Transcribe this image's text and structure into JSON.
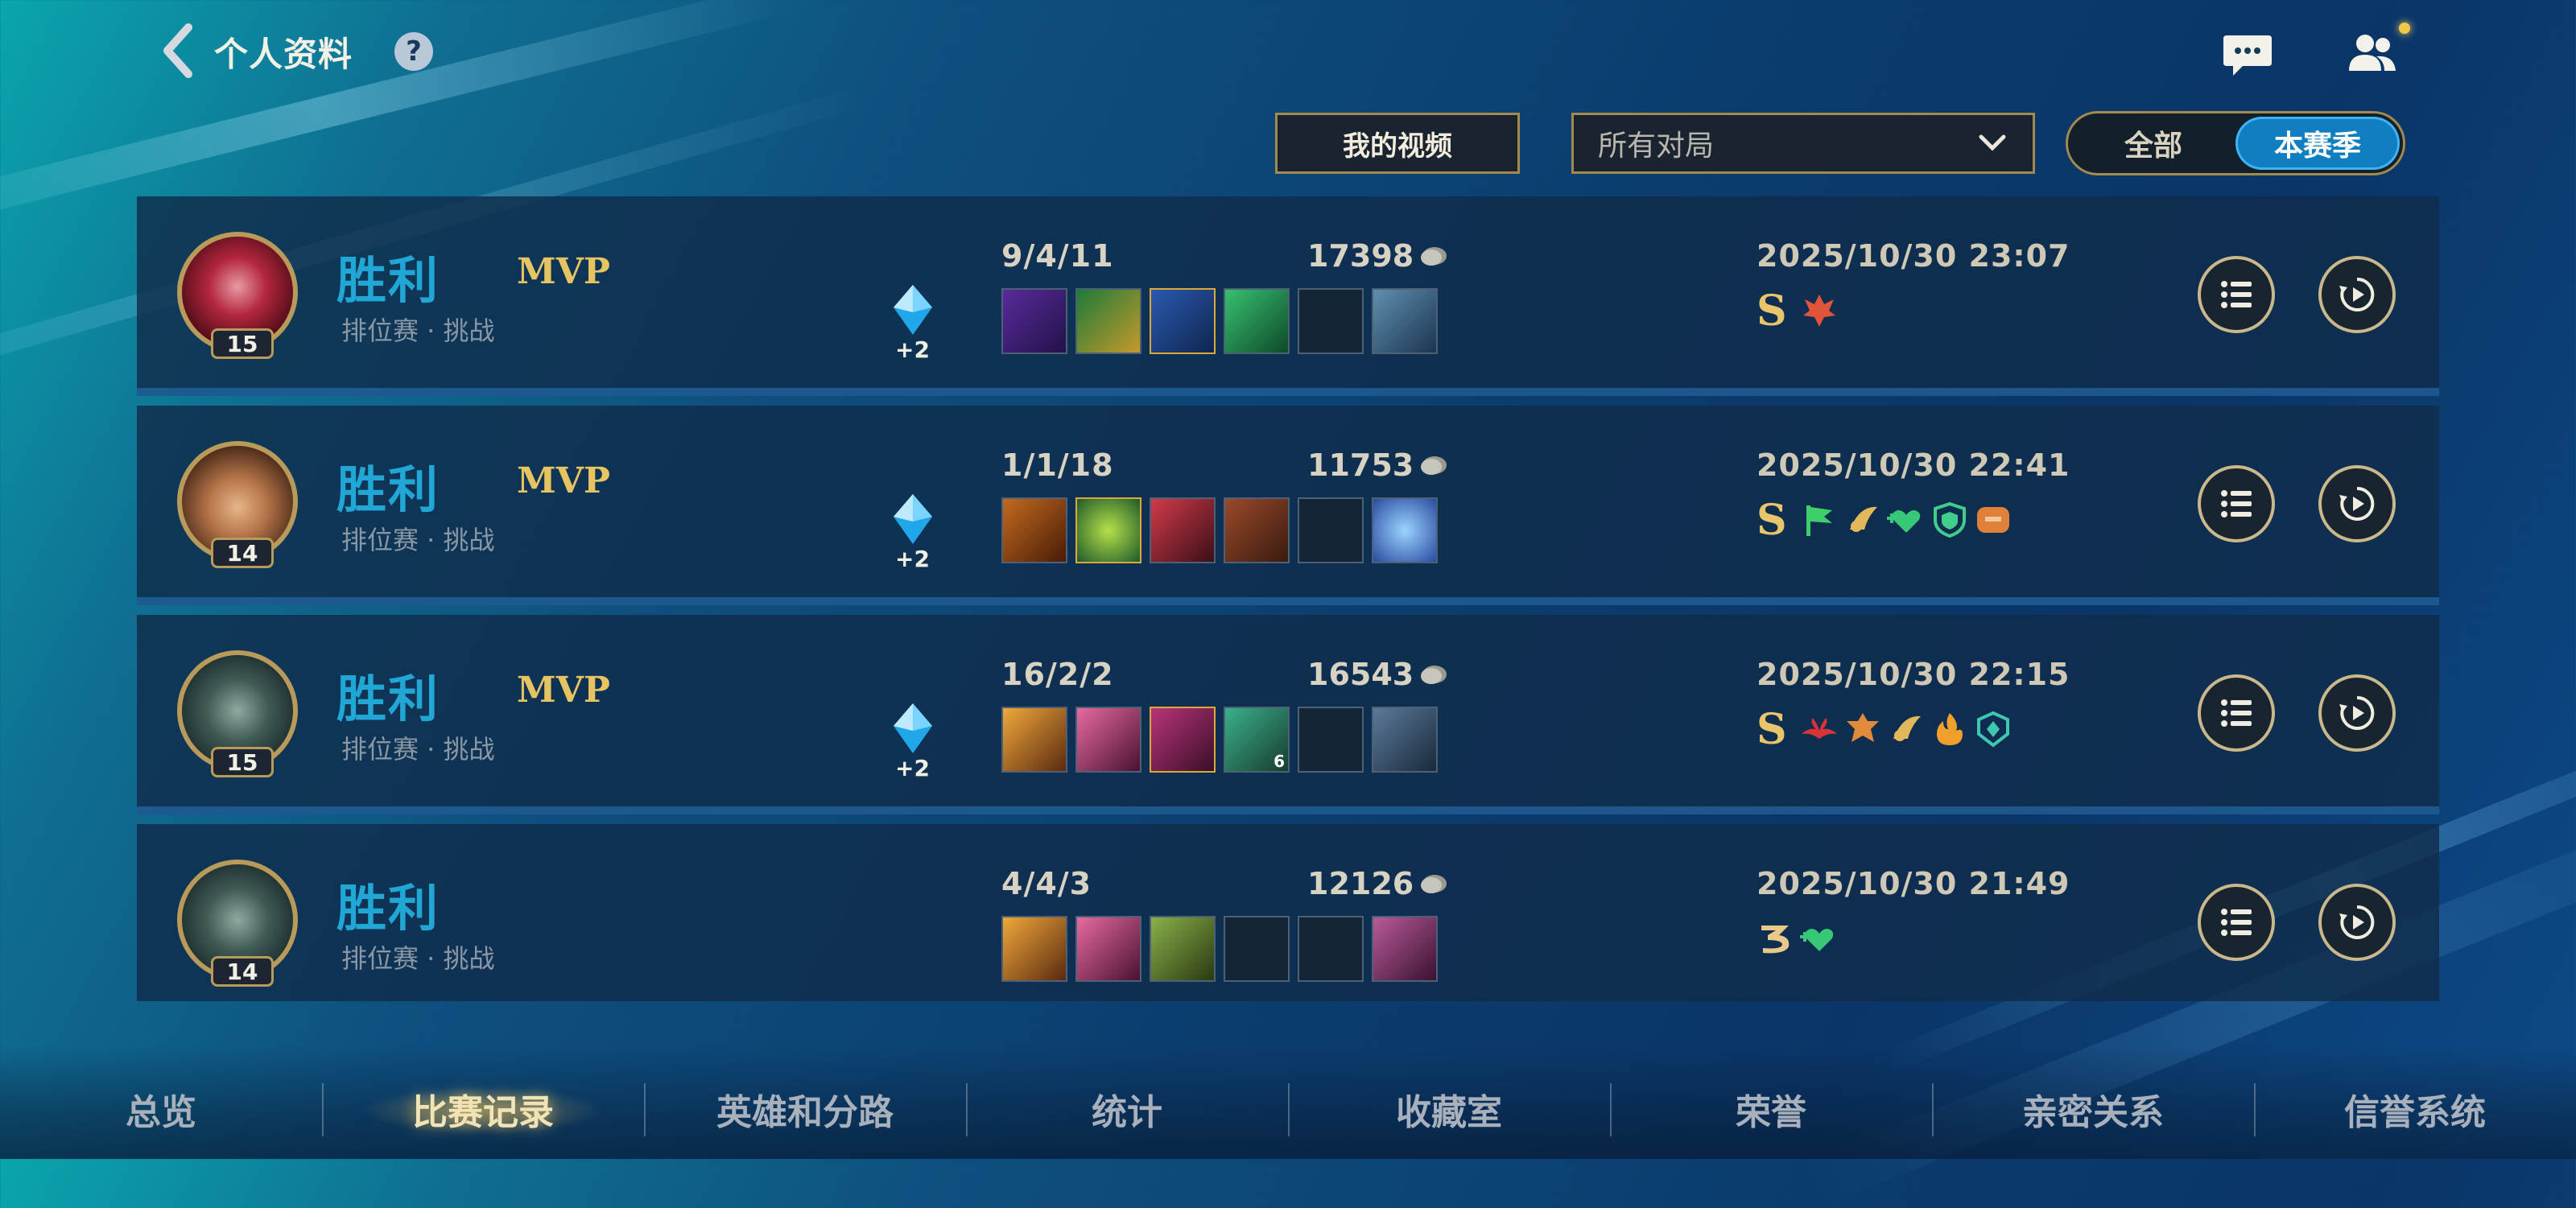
{
  "header": {
    "title": "个人资料",
    "help_label": "?"
  },
  "filters": {
    "my_video_label": "我的视频",
    "match_filter_value": "所有对局",
    "season_toggle": {
      "all_label": "全部",
      "season_label": "本赛季",
      "active": "本赛季"
    }
  },
  "matches": [
    {
      "level": "15",
      "result": "胜利",
      "mvp": "MVP",
      "mode": "排位赛 · 挑战",
      "gem_bonus": "+2",
      "kda": "9/4/11",
      "gold": "17398",
      "datetime": "2025/10/30 23:07",
      "grade": "S",
      "items": [
        "purple-sword",
        "golden-cross",
        "blue-blade",
        "green-cannon",
        "empty",
        "ward-trinket"
      ],
      "badges": [
        "red-flame-badge"
      ]
    },
    {
      "level": "14",
      "result": "胜利",
      "mvp": "MVP",
      "mode": "排位赛 · 挑战",
      "gem_bonus": "+2",
      "kda": "1/1/18",
      "gold": "11753",
      "datetime": "2025/10/30 22:41",
      "grade": "S",
      "items": [
        "orange-armor",
        "green-orb",
        "red-mask",
        "spell-book",
        "empty",
        "blue-lens"
      ],
      "badges": [
        "green-flag-badge",
        "gold-feather-badge",
        "green-heart-badge",
        "green-shield-badge",
        "orange-pig-badge"
      ]
    },
    {
      "level": "15",
      "result": "胜利",
      "mvp": "MVP",
      "mode": "排位赛 · 挑战",
      "gem_bonus": "+2",
      "kda": "16/2/2",
      "gold": "16543",
      "datetime": "2025/10/30 22:15",
      "grade": "S",
      "items": [
        "gold-claw",
        "pink-blade",
        "pink-dagger",
        "green-cannon",
        "empty",
        "stealth-ward"
      ],
      "badges": [
        "red-wings-badge",
        "orange-crest-badge",
        "gold-feather-badge",
        "orange-fire-badge",
        "teal-shield-badge"
      ]
    },
    {
      "level": "14",
      "result": "胜利",
      "mvp": "",
      "mode": "排位赛 · 挑战",
      "gem_bonus": "",
      "kda": "4/4/3",
      "gold": "12126",
      "datetime": "2025/10/30 21:49",
      "grade": "",
      "items": [
        "gold-claw",
        "pink-blade",
        "green-spear",
        "empty",
        "empty",
        "boots-trinket"
      ],
      "badges": [
        "gold-three-badge",
        "green-heart-badge"
      ]
    }
  ],
  "bottom_nav": {
    "tabs": [
      "总览",
      "比赛记录",
      "英雄和分路",
      "统计",
      "收藏室",
      "荣誉",
      "亲密关系",
      "信誉系统"
    ],
    "active": "比赛记录"
  },
  "colors": {
    "victory": "#21a7d6",
    "mvp_gold": "#e6c462",
    "accent_blue": "#0f7fc2",
    "frame_gold": "#a38a4d"
  }
}
